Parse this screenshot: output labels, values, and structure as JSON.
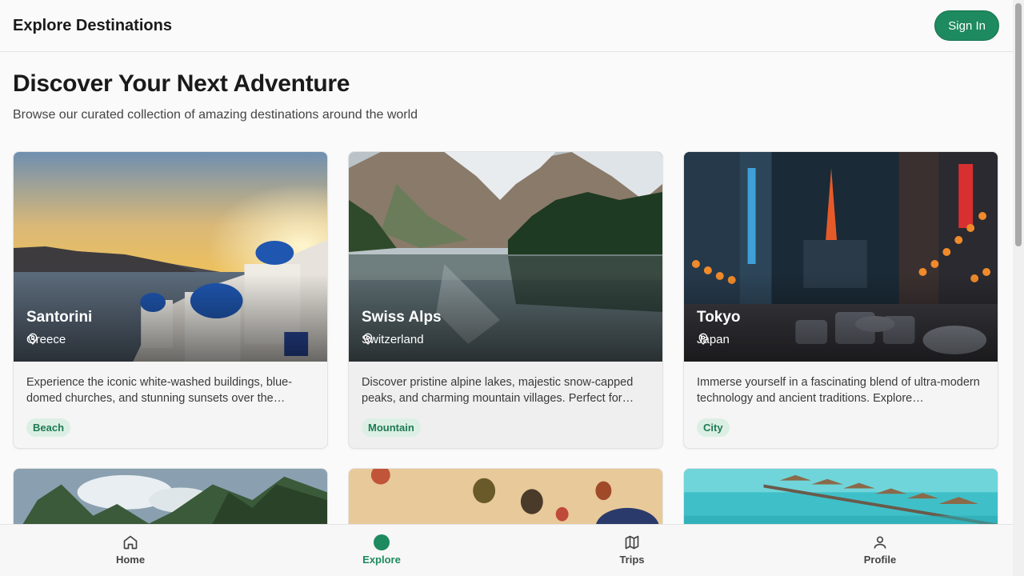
{
  "header": {
    "title": "Explore Destinations",
    "signin_label": "Sign In"
  },
  "hero": {
    "title": "Discover Your Next Adventure",
    "subtitle": "Browse our curated collection of amazing destinations around the world"
  },
  "destinations": [
    {
      "name": "Santorini",
      "location": "Greece",
      "description": "Experience the iconic white-washed buildings, blue-domed churches, and stunning sunsets over the…",
      "tag": "Beach"
    },
    {
      "name": "Swiss Alps",
      "location": "Switzerland",
      "description": "Discover pristine alpine lakes, majestic snow-capped peaks, and charming mountain villages. Perfect for…",
      "tag": "Mountain"
    },
    {
      "name": "Tokyo",
      "location": "Japan",
      "description": "Immerse yourself in a fascinating blend of ultra-modern technology and ancient traditions. Explore…",
      "tag": "City"
    }
  ],
  "nav": [
    {
      "label": "Home",
      "icon": "home-icon"
    },
    {
      "label": "Explore",
      "icon": "explore-dot-icon"
    },
    {
      "label": "Trips",
      "icon": "map-icon"
    },
    {
      "label": "Profile",
      "icon": "user-icon"
    }
  ],
  "colors": {
    "accent": "#1e8a5f",
    "tag_bg": "#dcefe5",
    "tag_text": "#1e7a52"
  }
}
